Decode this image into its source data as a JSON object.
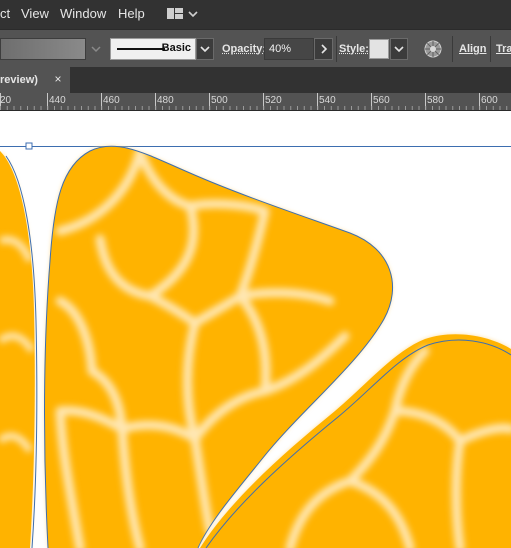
{
  "menubar": {
    "items": [
      "ct",
      "View",
      "Window",
      "Help"
    ],
    "workspace_icon": "workspace-layout-icon"
  },
  "controlbar": {
    "stroke_profile": "Basic",
    "opacity_label": "Opacity:",
    "opacity_value": "40%",
    "style_label": "Style:",
    "align_label": "Align",
    "transform_label": "Tra",
    "recolor_icon": "recolor-artwork-icon"
  },
  "tab": {
    "title": "review)",
    "close": "×"
  },
  "ruler": {
    "labels": [
      "20",
      "440",
      "460",
      "480",
      "500",
      "520",
      "540",
      "560",
      "580",
      "600"
    ]
  },
  "colors": {
    "petal_fill": "#ffb300",
    "petal_vein": "#ffe3a6",
    "selection_path": "#3d6eb0",
    "ui_dark": "#323232",
    "ui_mid": "#535353"
  }
}
